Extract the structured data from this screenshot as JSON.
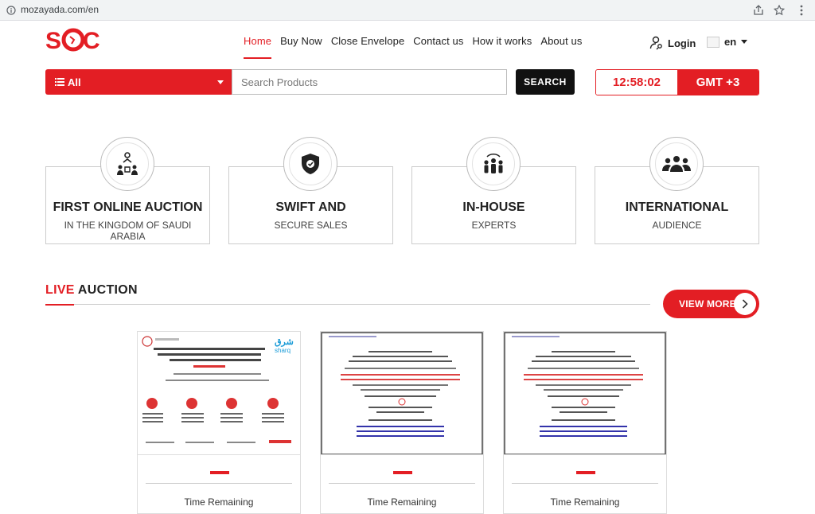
{
  "browser": {
    "url": "mozayada.com/en"
  },
  "header": {
    "logo_text": "SQC",
    "nav": [
      {
        "label": "Home",
        "active": true
      },
      {
        "label": "Buy Now",
        "active": false
      },
      {
        "label": "Close Envelope",
        "active": false
      },
      {
        "label": "Contact us",
        "active": false
      },
      {
        "label": "How it works",
        "active": false
      },
      {
        "label": "About us",
        "active": false
      }
    ],
    "login_label": "Login",
    "language": "en"
  },
  "search": {
    "category": "All",
    "placeholder": "Search Products",
    "button_label": "SEARCH"
  },
  "clock": {
    "time": "12:58:02",
    "zone": "GMT +3"
  },
  "features": [
    {
      "title": "FIRST ONLINE AUCTION",
      "subtitle": "IN THE KINGDOM OF SAUDI ARABIA",
      "icon": "auction-people-icon"
    },
    {
      "title": "SWIFT AND",
      "subtitle": "SECURE SALES",
      "icon": "shield-check-icon"
    },
    {
      "title": "IN-HOUSE",
      "subtitle": "EXPERTS",
      "icon": "experts-team-icon"
    },
    {
      "title": "INTERNATIONAL",
      "subtitle": "AUDIENCE",
      "icon": "audience-group-icon"
    }
  ],
  "live_auction": {
    "title_highlight": "LIVE",
    "title_rest": " AUCTION",
    "view_more_label": "VIEW MORE",
    "cards": [
      {
        "time_label": "Time Remaining"
      },
      {
        "time_label": "Time Remaining"
      },
      {
        "time_label": "Time Remaining"
      }
    ]
  },
  "colors": {
    "accent": "#e31e24",
    "dark": "#111111"
  }
}
